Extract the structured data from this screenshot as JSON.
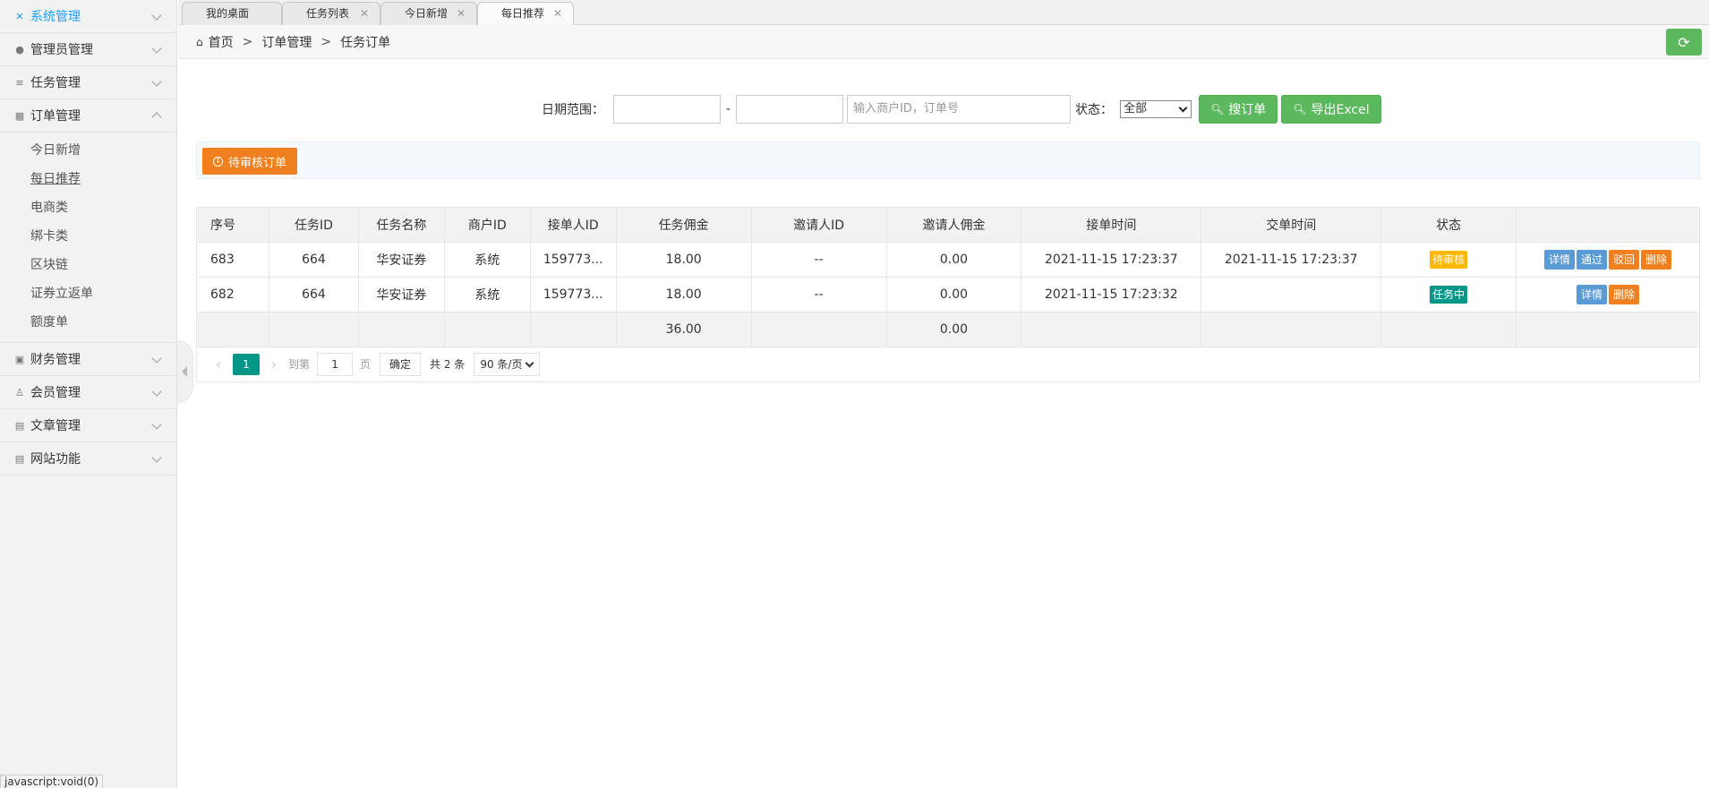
{
  "sidebar": {
    "menus": [
      {
        "label": "系统管理",
        "icon": "wrench-icon",
        "active": true
      },
      {
        "label": "管理员管理",
        "icon": "user-icon"
      },
      {
        "label": "任务管理",
        "icon": "database-icon"
      },
      {
        "label": "订单管理",
        "icon": "table-icon",
        "expanded": true
      }
    ],
    "submenu": [
      "今日新增",
      "每日推荐",
      "电商类",
      "绑卡类",
      "区块链",
      "证券立返单",
      "额度单"
    ],
    "menus_after": [
      {
        "label": "财务管理",
        "icon": "calendar-icon"
      },
      {
        "label": "会员管理",
        "icon": "member-icon"
      },
      {
        "label": "文章管理",
        "icon": "document-icon"
      },
      {
        "label": "网站功能",
        "icon": "globe-icon"
      }
    ]
  },
  "status_bar": "javascript:void(0)",
  "tabs": [
    "我的桌面",
    "任务列表",
    "今日新增",
    "每日推荐"
  ],
  "breadcrumb": {
    "home": "首页",
    "level1": "订单管理",
    "level2": "任务订单",
    "separator": ">"
  },
  "search": {
    "date_label": "日期范围：",
    "date_dash": "-",
    "keyword_placeholder": "输入商户ID，订单号",
    "status_label": "状态：",
    "status_value": "全部",
    "search_button": "搜订单",
    "export_button": "导出Excel"
  },
  "pending_button": "待审核订单",
  "table": {
    "headers": [
      "序号",
      "任务ID",
      "任务名称",
      "商户ID",
      "接单人ID",
      "任务佣金",
      "邀请人ID",
      "邀请人佣金",
      "接单时间",
      "交单时间",
      "状态",
      ""
    ],
    "rows": [
      {
        "seq": "683",
        "task_id": "664",
        "task_name": "华安证券",
        "merchant": "系统",
        "taker": "159773...",
        "commission": "18.00",
        "inviter": "--",
        "inviter_commission": "0.00",
        "take_time": "2021-11-15 17:23:37",
        "submit_time": "2021-11-15 17:23:37",
        "status": "待审核",
        "status_color": "#ffb800",
        "actions": [
          "详情",
          "通过",
          "驳回",
          "删除"
        ]
      },
      {
        "seq": "682",
        "task_id": "664",
        "task_name": "华安证券",
        "merchant": "系统",
        "taker": "159773...",
        "commission": "18.00",
        "inviter": "--",
        "inviter_commission": "0.00",
        "take_time": "2021-11-15 17:23:32",
        "submit_time": "",
        "status": "任务中",
        "status_color": "#009688",
        "actions": [
          "详情",
          "删除"
        ]
      }
    ],
    "total": {
      "commission": "36.00",
      "inviter_commission": "0.00"
    }
  },
  "pager": {
    "current": "1",
    "goto_label": "到第",
    "goto_value": "1",
    "page_label": "页",
    "confirm": "确定",
    "total": "共 2 条",
    "page_size": "90 条/页"
  },
  "colors": {
    "green": "#5cb85c",
    "orange": "#f0801f",
    "teal": "#009688",
    "active_menu": "#1e9fff"
  }
}
